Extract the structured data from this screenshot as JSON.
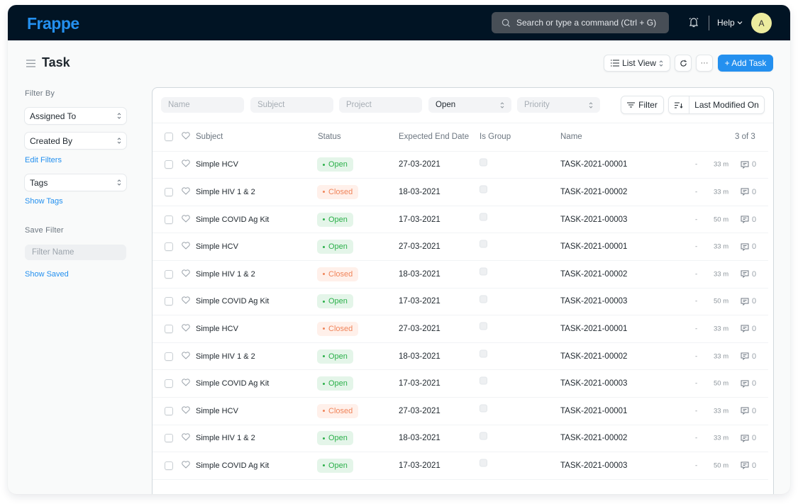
{
  "app": {
    "logo": "Frappe",
    "search_placeholder": "Search or type a command (Ctrl + G)",
    "help_label": "Help",
    "avatar_initial": "A"
  },
  "page": {
    "title": "Task",
    "list_view_label": "List View",
    "more_label": "···",
    "add_button_label": "+ Add Task"
  },
  "sidebar": {
    "filter_by_label": "Filter By",
    "assigned_to": "Assigned To",
    "created_by": "Created By",
    "edit_filters": "Edit Filters",
    "tags": "Tags",
    "show_tags": "Show Tags",
    "save_filter_label": "Save Filter",
    "filter_name_placeholder": "Filter Name",
    "show_saved": "Show Saved"
  },
  "filters": {
    "name_placeholder": "Name",
    "subject_placeholder": "Subject",
    "project_placeholder": "Project",
    "status_value": "Open",
    "priority_placeholder": "Priority",
    "filter_button": "Filter",
    "sort_label": "Last Modified On"
  },
  "table": {
    "columns": {
      "subject": "Subject",
      "status": "Status",
      "expected_end_date": "Expected End Date",
      "is_group": "Is Group",
      "name": "Name"
    },
    "count": "3 of 3",
    "rows": [
      {
        "subject": "Simple HCV",
        "status": "Open",
        "date": "27-03-2021",
        "name": "TASK-2021-00001",
        "assigned": "-",
        "modified": "33 m",
        "comments": "0"
      },
      {
        "subject": "Simple HIV 1 & 2",
        "status": "Closed",
        "date": "18-03-2021",
        "name": "TASK-2021-00002",
        "assigned": "-",
        "modified": "33 m",
        "comments": "0"
      },
      {
        "subject": "Simple COVID Ag Kit",
        "status": "Open",
        "date": "17-03-2021",
        "name": "TASK-2021-00003",
        "assigned": "-",
        "modified": "50 m",
        "comments": "0"
      },
      {
        "subject": "Simple HCV",
        "status": "Open",
        "date": "27-03-2021",
        "name": "TASK-2021-00001",
        "assigned": "-",
        "modified": "33 m",
        "comments": "0"
      },
      {
        "subject": "Simple HIV 1 & 2",
        "status": "Closed",
        "date": "18-03-2021",
        "name": "TASK-2021-00002",
        "assigned": "-",
        "modified": "33 m",
        "comments": "0"
      },
      {
        "subject": "Simple COVID Ag Kit",
        "status": "Open",
        "date": "17-03-2021",
        "name": "TASK-2021-00003",
        "assigned": "-",
        "modified": "50 m",
        "comments": "0"
      },
      {
        "subject": "Simple HCV",
        "status": "Closed",
        "date": "27-03-2021",
        "name": "TASK-2021-00001",
        "assigned": "-",
        "modified": "33 m",
        "comments": "0"
      },
      {
        "subject": "Simple HIV 1 & 2",
        "status": "Open",
        "date": "18-03-2021",
        "name": "TASK-2021-00002",
        "assigned": "-",
        "modified": "33 m",
        "comments": "0"
      },
      {
        "subject": "Simple COVID Ag Kit",
        "status": "Open",
        "date": "17-03-2021",
        "name": "TASK-2021-00003",
        "assigned": "-",
        "modified": "50 m",
        "comments": "0"
      },
      {
        "subject": "Simple HCV",
        "status": "Closed",
        "date": "27-03-2021",
        "name": "TASK-2021-00001",
        "assigned": "-",
        "modified": "33 m",
        "comments": "0"
      },
      {
        "subject": "Simple HIV 1 & 2",
        "status": "Open",
        "date": "18-03-2021",
        "name": "TASK-2021-00002",
        "assigned": "-",
        "modified": "33 m",
        "comments": "0"
      },
      {
        "subject": "Simple COVID Ag Kit",
        "status": "Open",
        "date": "17-03-2021",
        "name": "TASK-2021-00003",
        "assigned": "-",
        "modified": "50 m",
        "comments": "0"
      }
    ]
  },
  "colors": {
    "brand": "#2490ef",
    "navbar": "#011424",
    "open": "#2bb04a",
    "closed": "#f0845a"
  }
}
